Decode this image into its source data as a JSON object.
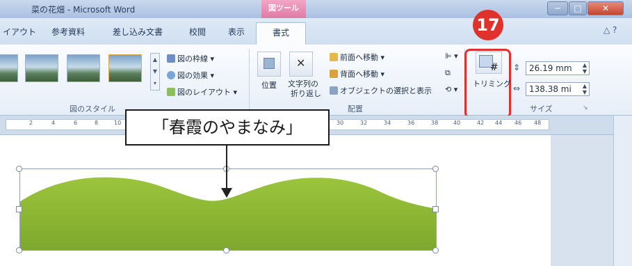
{
  "window": {
    "title": "菜の花畑 - Microsoft Word",
    "context_tab": "図ツール",
    "controls": {
      "minimize": "─",
      "maximize": "□",
      "close": "✕"
    }
  },
  "tabs": {
    "items": [
      "イアウト",
      "参考資料",
      "差し込み文書",
      "校閲",
      "表示"
    ],
    "active": "書式"
  },
  "help": "△ ?",
  "ribbon": {
    "picture_styles": {
      "label": "図のスタイル",
      "border": "図の枠線",
      "effects": "図の効果",
      "layout": "図のレイアウト"
    },
    "arrange": {
      "label": "配置",
      "position": "位置",
      "wrap_line1": "文字列の",
      "wrap_line2": "折り返し",
      "bring_forward": "前面へ移動",
      "send_backward": "背面へ移動",
      "selection_pane": "オブジェクトの選択と表示"
    },
    "size": {
      "label": "サイズ",
      "crop": "トリミング",
      "height": "26.19 mm",
      "width": "138.38 mi"
    }
  },
  "callout": {
    "number": "17"
  },
  "ruler": {
    "ticks": [
      "2",
      "4",
      "6",
      "8",
      "10",
      "30",
      "32",
      "34",
      "36",
      "38",
      "40",
      "42",
      "44",
      "46",
      "48"
    ]
  },
  "annotation": {
    "text": "「春霞のやまなみ」"
  },
  "colors": {
    "accent": "#e0322c",
    "hill": "#8fb935"
  }
}
